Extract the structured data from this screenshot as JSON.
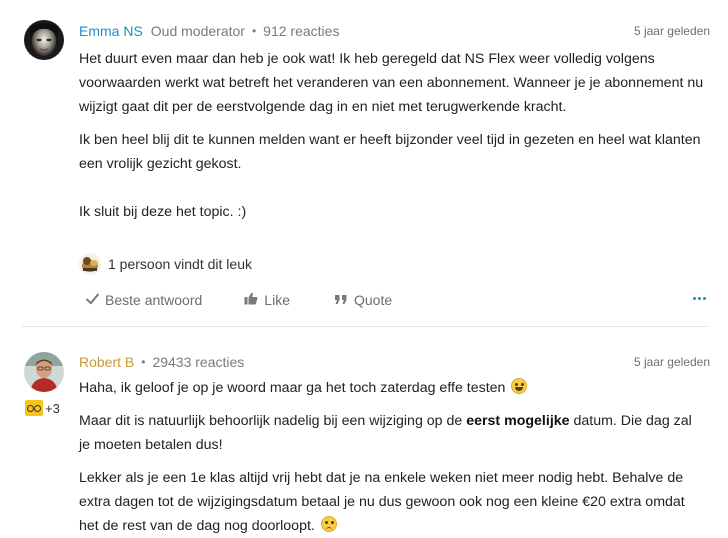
{
  "posts": [
    {
      "author": "Emma NS",
      "role": "Oud moderator",
      "separator": "•",
      "replies": "912 reacties",
      "time": "5 jaar geleden",
      "paragraphs": [
        "Het duurt even maar dan heb je ook wat! Ik heb geregeld dat NS Flex weer volledig volgens voorwaarden werkt wat betreft het veranderen van een abonnement. Wanneer je je abonnement nu wijzigt gaat dit per de eerstvolgende dag in en niet met terugwerkende kracht.",
        "Ik ben heel blij dit te kunnen melden want er heeft bijzonder veel tijd in gezeten en heel wat klanten een vrolijk gezicht gekost.",
        "Ik sluit bij deze het topic. :)"
      ],
      "likes_text": "1 persoon vindt dit leuk",
      "actions": {
        "best_answer": "Beste antwoord",
        "like": "Like",
        "quote": "Quote"
      }
    },
    {
      "author": "Robert B",
      "separator": "•",
      "replies": "29433 reacties",
      "time": "5 jaar geleden",
      "badge_extra": "+3",
      "p1": "Haha, ik geloof je op je woord maar ga het toch zaterdag effe testen",
      "p2_before": "Maar dit is natuurlijk behoorlijk nadelig bij een wijziging op de ",
      "p2_bold": "eerst mogelijke",
      "p2_after": " datum. Die dag zal je moeten betalen dus!",
      "p3": "Lekker als je een 1e klas altijd vrij hebt dat je na enkele weken niet meer nodig hebt. Behalve de extra dagen tot de wijzigingsdatum betaal je nu dus gewoon ook nog een kleine €20 extra omdat het de rest van de dag nog doorloopt."
    }
  ],
  "icons": {
    "best_answer": "checkmark-icon",
    "like": "thumbs-up-icon",
    "quote": "quote-icon",
    "more": "more-options-icon",
    "laugh": "laughing-emoji",
    "sad": "sad-emoji",
    "badge": "glasses-badge-icon"
  },
  "colors": {
    "author_link": "#1d8fc6",
    "author_ochre": "#c7993a",
    "meta_grey": "#7a7a7a",
    "badge_yellow": "#f5c518"
  }
}
